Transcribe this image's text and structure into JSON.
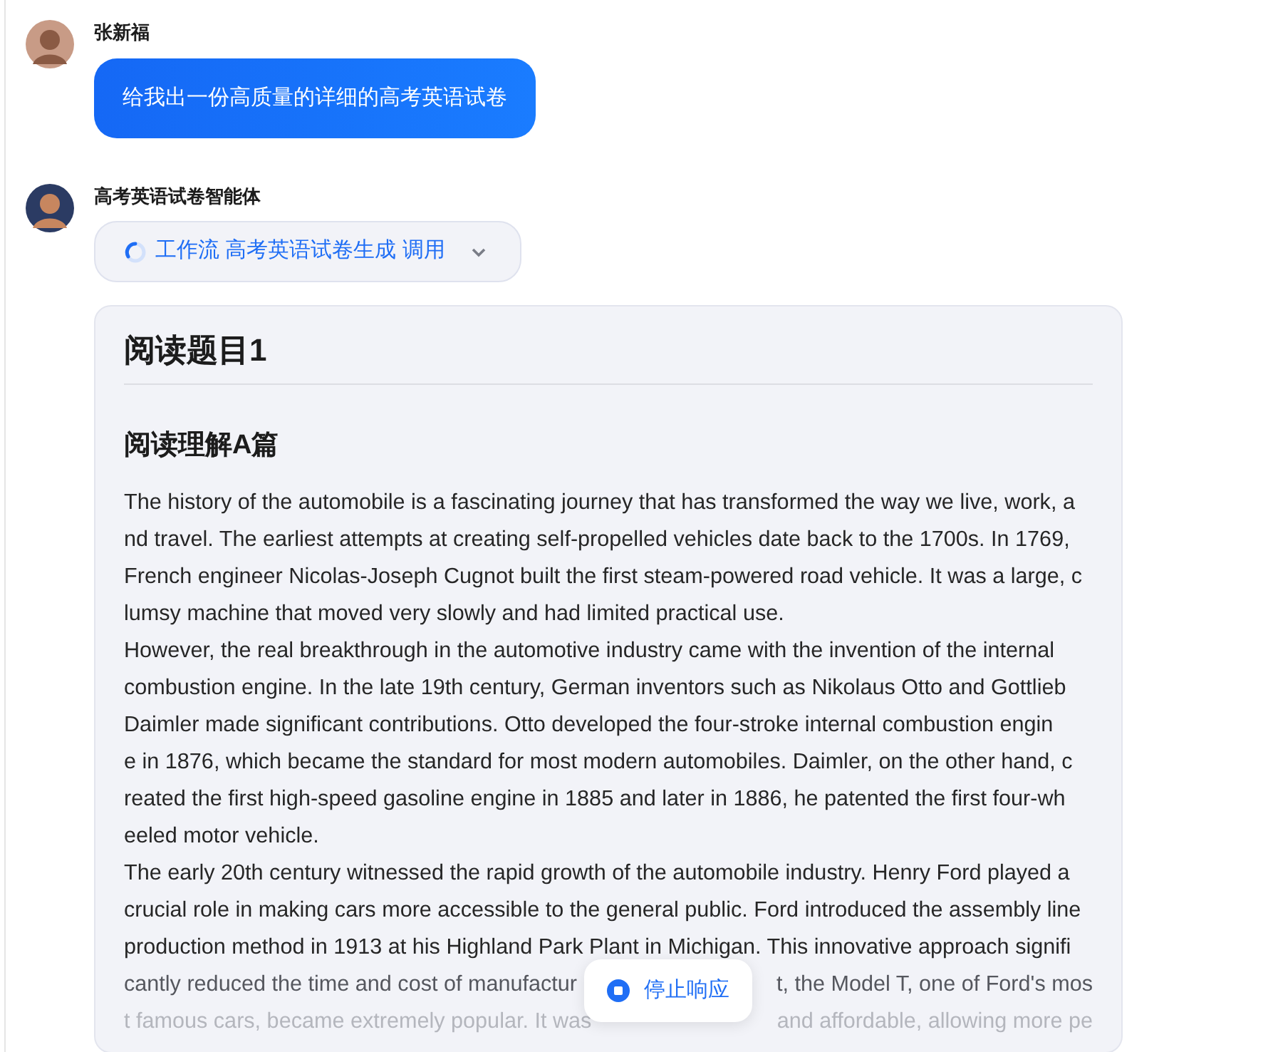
{
  "conversation": [
    {
      "kind": "user",
      "name": "张新福",
      "message": "给我出一份高质量的详细的高考英语试卷"
    },
    {
      "kind": "agent",
      "name": "高考英语试卷智能体",
      "workflow": "工作流 高考英语试卷生成 调用",
      "document": {
        "heading": "阅读题目1",
        "subheading": "阅读理解A篇",
        "paragraphs": [
          {
            "lines": [
              [
                "The history of the automobile is a fascinating journey that has transformed the way we live, work, a"
              ],
              [
                "nd travel. The earliest attempts at creating self-propelled vehicles date back to the 1700s. In 1769,"
              ],
              [
                "French engineer Nicolas-Joseph Cugnot built the first steam-powered road vehicle. It was a large, c"
              ],
              [
                "lumsy machine that moved very slowly and had limited practical use."
              ]
            ]
          },
          {
            "lines": [
              [
                "However, the real breakthrough in the automotive industry came with the invention of the internal"
              ],
              [
                "combustion engine. In the late 19th century, German inventors such as Nikolaus Otto and Gottlieb"
              ],
              [
                "Daimler made significant contributions. Otto developed the four-stroke internal combustion engin"
              ],
              [
                "e in 1876, which became the standard for most modern automobiles. Daimler, on the other hand, c"
              ],
              [
                "reated the first high-speed gasoline engine in 1885 and later in 1886, he patented the first four-wh"
              ],
              [
                "eeled motor vehicle."
              ]
            ]
          },
          {
            "lines": [
              [
                "The early 20th century witnessed the rapid growth of the automobile industry. Henry Ford played a"
              ],
              [
                "crucial role in making cars more accessible to the general public. Ford introduced the assembly line"
              ],
              [
                "production method in 1913 at his Highland Park Plant in Michigan. This innovative approach signifi"
              ],
              [
                "cantly reduced the time and cost of manufactur",
                "t, the Model T, one of Ford's mos"
              ],
              [
                "t famous cars, became extremely popular. It was",
                "and affordable, allowing more pe"
              ]
            ]
          }
        ]
      }
    }
  ],
  "stop_button": "停止响应"
}
